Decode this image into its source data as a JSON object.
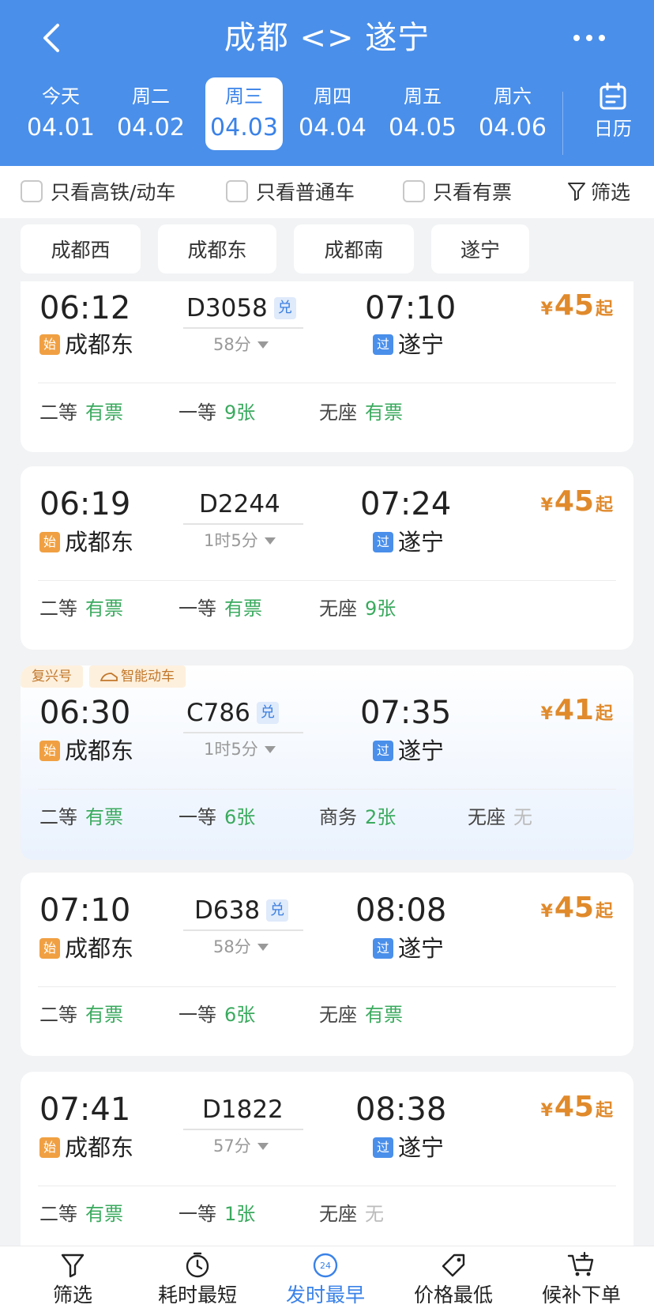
{
  "header": {
    "title": "成都 <> 遂宁",
    "dates": [
      {
        "week": "今天",
        "date": "04.01"
      },
      {
        "week": "周二",
        "date": "04.02"
      },
      {
        "week": "周三",
        "date": "04.03"
      },
      {
        "week": "周四",
        "date": "04.04"
      },
      {
        "week": "周五",
        "date": "04.05"
      },
      {
        "week": "周六",
        "date": "04.06"
      }
    ],
    "calendar_label": "日历"
  },
  "filters": {
    "high_speed_only": "只看高铁/动车",
    "normal_only": "只看普通车",
    "available_only": "只看有票",
    "filter_label": "筛选"
  },
  "stations": [
    "成都西",
    "成都东",
    "成都南",
    "遂宁"
  ],
  "badges": {
    "start": "始",
    "pass": "过",
    "dui": "兑"
  },
  "price_prefix": "¥",
  "price_suffix": "起",
  "tags": {
    "fuxing": "复兴号",
    "smart": "智能动车"
  },
  "trains": [
    {
      "dep_time": "06:12",
      "train_no": "D3058",
      "arr_time": "07:10",
      "duration": "58分",
      "from": "成都东",
      "to": "遂宁",
      "price": "45",
      "seats": [
        {
          "name": "二等",
          "avail": "有票"
        },
        {
          "name": "一等",
          "avail": "9张"
        },
        {
          "name": "无座",
          "avail": "有票"
        }
      ]
    },
    {
      "dep_time": "06:19",
      "train_no": "D2244",
      "arr_time": "07:24",
      "duration": "1时5分",
      "from": "成都东",
      "to": "遂宁",
      "price": "45",
      "seats": [
        {
          "name": "二等",
          "avail": "有票"
        },
        {
          "name": "一等",
          "avail": "有票"
        },
        {
          "name": "无座",
          "avail": "9张"
        }
      ]
    },
    {
      "dep_time": "06:30",
      "train_no": "C786",
      "arr_time": "07:35",
      "duration": "1时5分",
      "from": "成都东",
      "to": "遂宁",
      "price": "41",
      "seats": [
        {
          "name": "二等",
          "avail": "有票"
        },
        {
          "name": "一等",
          "avail": "6张"
        },
        {
          "name": "商务",
          "avail": "2张"
        },
        {
          "name": "无座",
          "avail": "无"
        }
      ]
    },
    {
      "dep_time": "07:10",
      "train_no": "D638",
      "arr_time": "08:08",
      "duration": "58分",
      "from": "成都东",
      "to": "遂宁",
      "price": "45",
      "seats": [
        {
          "name": "二等",
          "avail": "有票"
        },
        {
          "name": "一等",
          "avail": "6张"
        },
        {
          "name": "无座",
          "avail": "有票"
        }
      ]
    },
    {
      "dep_time": "07:41",
      "train_no": "D1822",
      "arr_time": "08:38",
      "duration": "57分",
      "from": "成都东",
      "to": "遂宁",
      "price": "45",
      "seats": [
        {
          "name": "二等",
          "avail": "有票"
        },
        {
          "name": "一等",
          "avail": "1张"
        },
        {
          "name": "无座",
          "avail": "无"
        }
      ]
    }
  ],
  "bottom_bar": [
    {
      "label": "筛选"
    },
    {
      "label": "耗时最短"
    },
    {
      "label": "发时最早"
    },
    {
      "label": "价格最低"
    },
    {
      "label": "候补下单"
    }
  ],
  "colors": {
    "header_bg": "#4a8fea",
    "accent": "#3a82e8",
    "price": "#e08a2c",
    "available": "#3aaa5e"
  }
}
